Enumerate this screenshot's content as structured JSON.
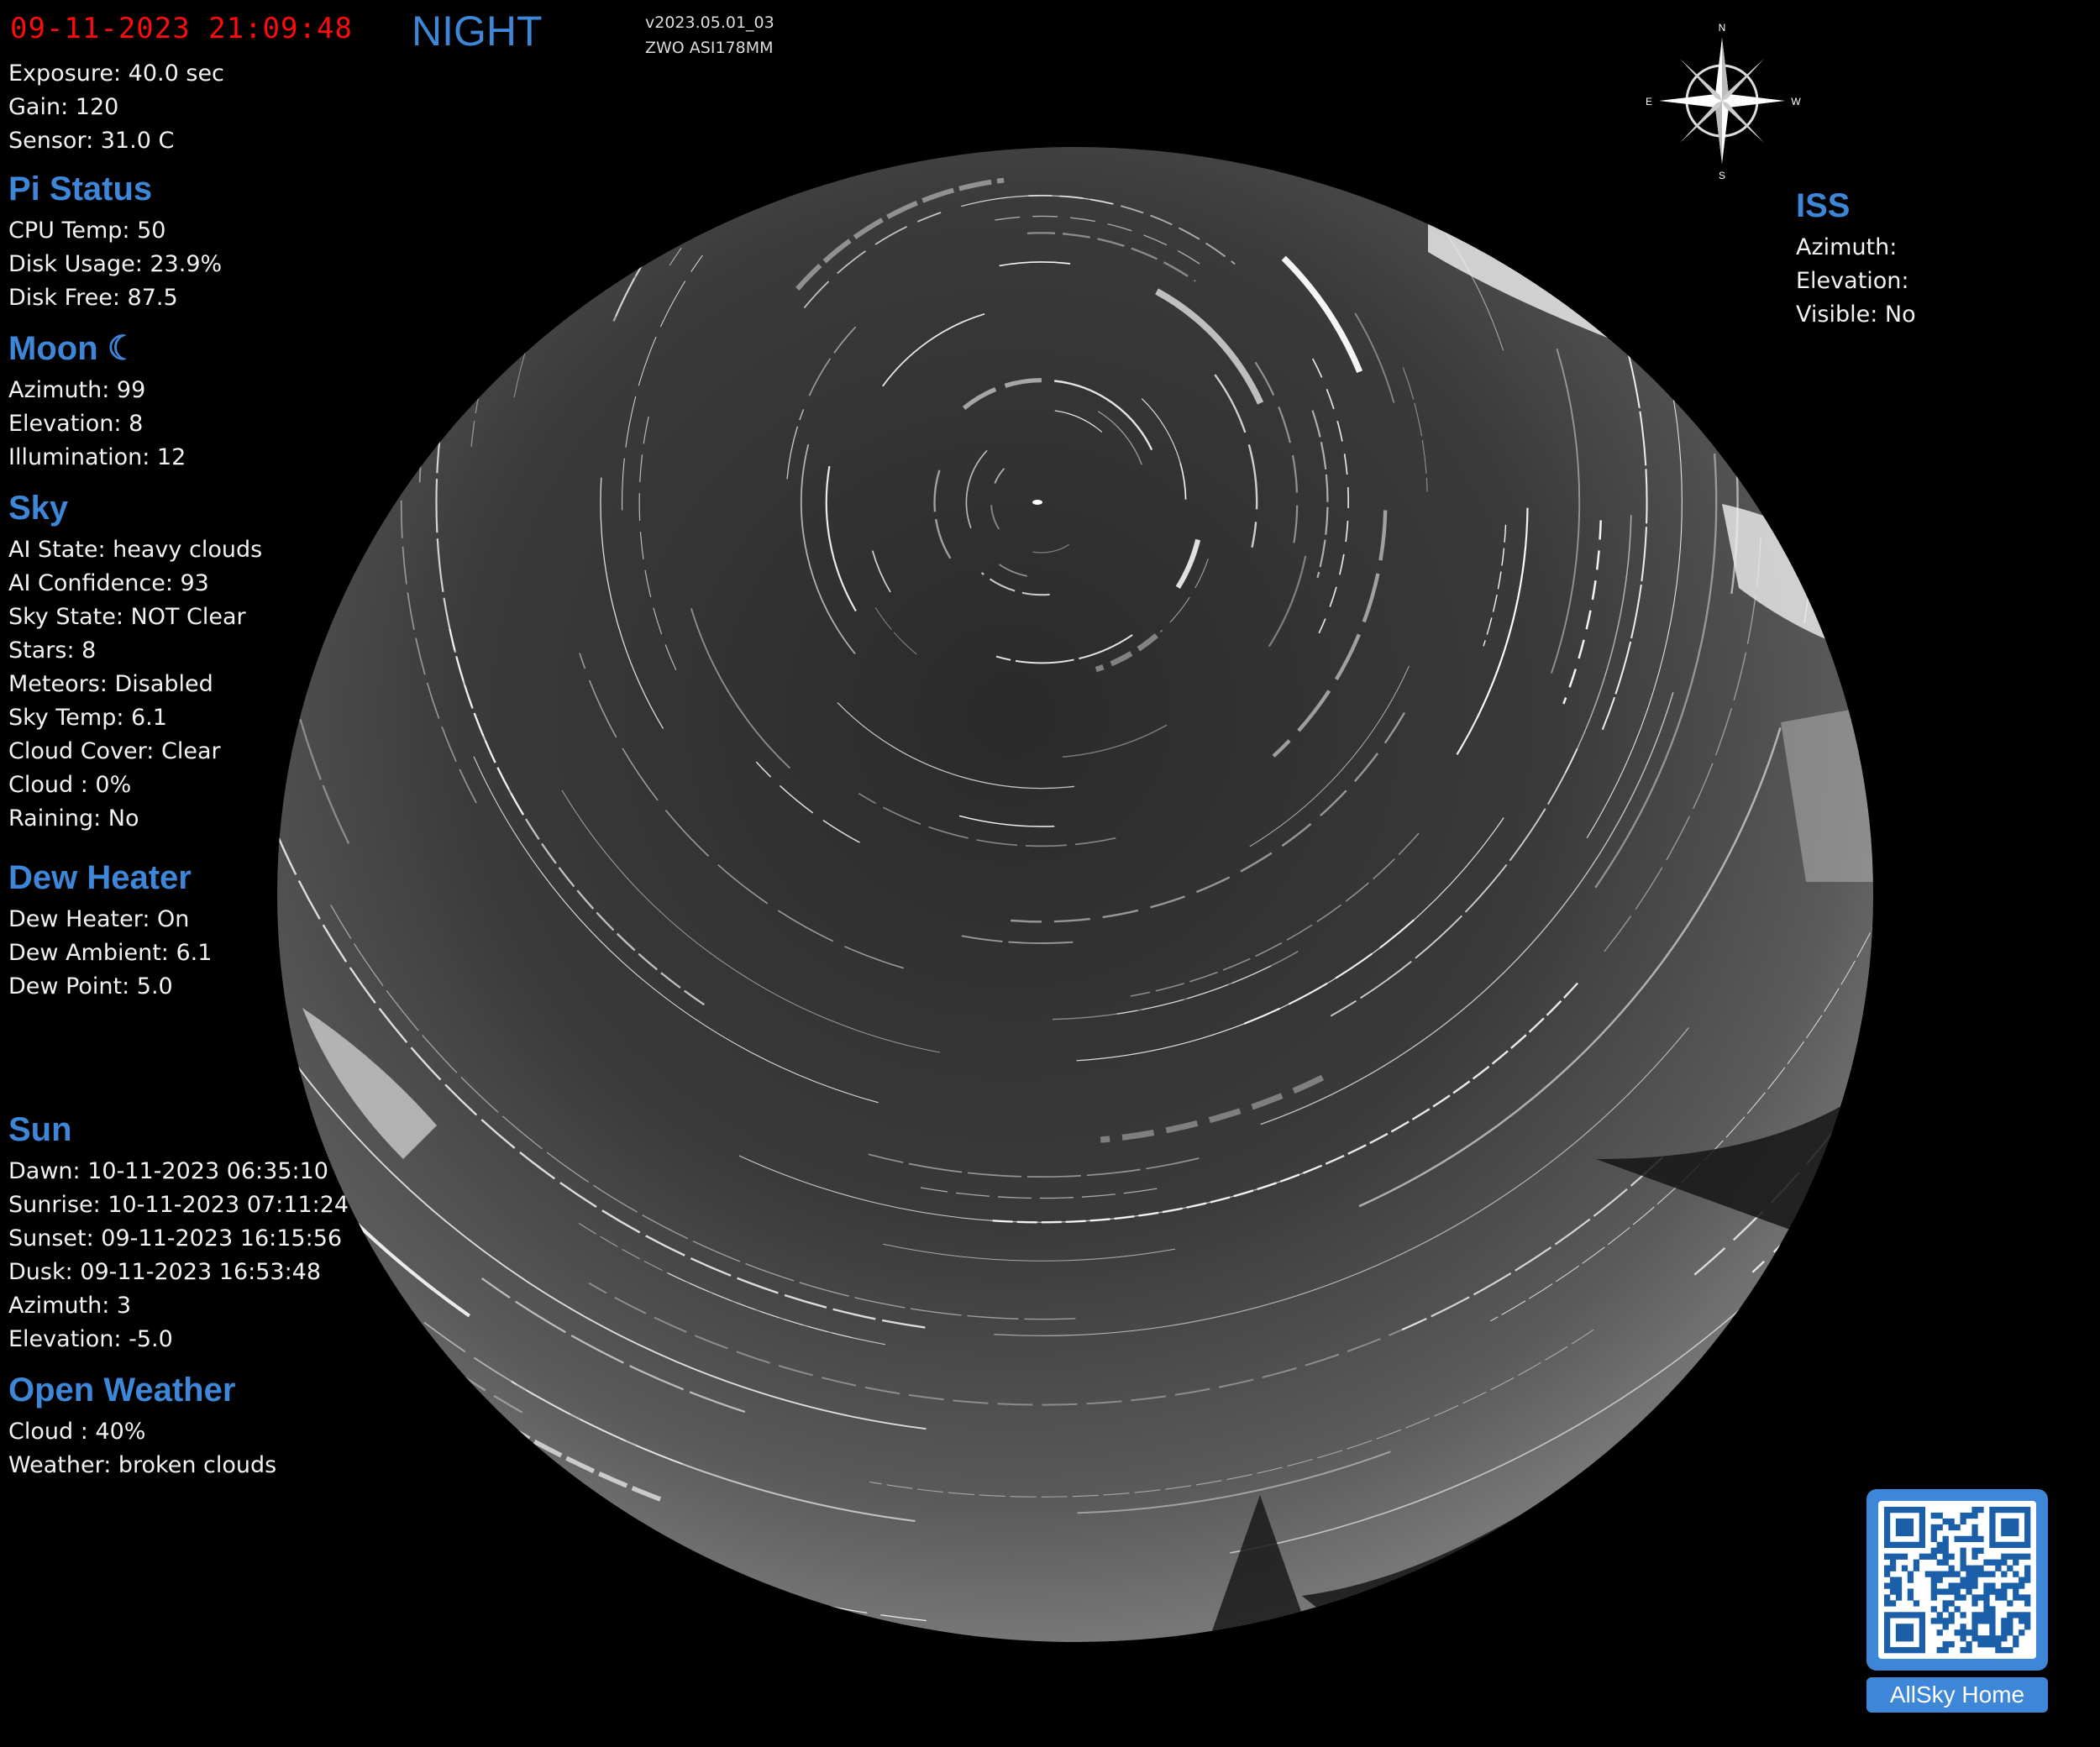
{
  "header": {
    "date_time_raw": "09-11-2023 21:09:48",
    "mode": "NIGHT",
    "version": "v2023.05.01_03",
    "camera_model": "ZWO ASI178MM"
  },
  "camera": {
    "exposure": "Exposure: 40.0 sec",
    "gain": "Gain: 120",
    "sensor": "Sensor: 31.0 C"
  },
  "pi_status": {
    "title": "Pi Status",
    "cpu_temp": "CPU Temp: 50",
    "disk_usage": "Disk Usage: 23.9%",
    "disk_free": "Disk Free: 87.5"
  },
  "moon": {
    "title": "Moon",
    "phase_icon": "crescent-moon-icon",
    "azimuth": "Azimuth: 99",
    "elevation": "Elevation: 8",
    "illumination": "Illumination: 12"
  },
  "sky": {
    "title": "Sky",
    "ai_state": "AI State: heavy clouds",
    "ai_confidence": "AI Confidence: 93",
    "sky_state": "Sky State: NOT Clear",
    "stars": "Stars: 8",
    "meteors": "Meteors: Disabled",
    "sky_temp": "Sky Temp: 6.1",
    "cloud_cover": "Cloud Cover: Clear",
    "cloud": "Cloud : 0%",
    "raining": "Raining: No"
  },
  "dew_heater": {
    "title": "Dew Heater",
    "status": "Dew Heater: On",
    "ambient": "Dew Ambient: 6.1",
    "dew_point": "Dew Point: 5.0"
  },
  "sun": {
    "title": "Sun",
    "dawn": "Dawn: 10-11-2023 06:35:10",
    "sunrise": "Sunrise: 10-11-2023 07:11:24",
    "sunset": "Sunset: 09-11-2023 16:15:56",
    "dusk": "Dusk: 09-11-2023 16:53:48",
    "azimuth": "Azimuth: 3",
    "elevation": "Elevation: -5.0"
  },
  "open_weather": {
    "title": "Open Weather",
    "cloud": "Cloud : 40%",
    "weather": "Weather: broken clouds"
  },
  "iss": {
    "title": "ISS",
    "azimuth": "Azimuth: ",
    "elevation": "Elevation: ",
    "visible": "Visible: No"
  },
  "compass": {
    "north": "N",
    "south": "S",
    "east": "E",
    "west": "W",
    "icon": "compass-rose-icon"
  },
  "qr": {
    "label": "AllSky Home",
    "icon": "qr-code-icon"
  },
  "colors": {
    "heading": "#3d86d8",
    "date_text": "#ff0b0b",
    "text": "#f2f2f2",
    "background": "#000000"
  }
}
